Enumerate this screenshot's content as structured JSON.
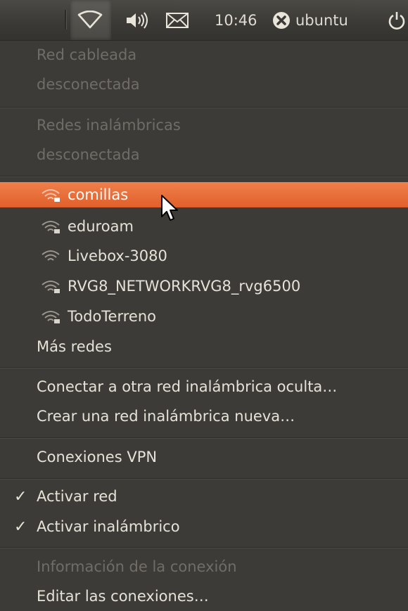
{
  "panel": {
    "time": "10:46",
    "user": "ubuntu"
  },
  "menu": {
    "wired_title": "Red cableada",
    "wired_status": "desconectada",
    "wireless_title": "Redes inalámbricas",
    "wireless_status": "desconectada",
    "networks": [
      {
        "label": "comillas",
        "selected": true
      },
      {
        "label": "eduroam"
      },
      {
        "label": "Livebox-3080"
      },
      {
        "label": "RVG8_NETWORKRVG8_rvg6500"
      },
      {
        "label": "TodoTerreno"
      }
    ],
    "more_networks": "Más redes",
    "connect_hidden": "Conectar a otra red inalámbrica oculta…",
    "create_new": "Crear una red inalámbrica nueva…",
    "vpn": "Conexiones VPN",
    "enable_network": "Activar red",
    "enable_wireless": "Activar inalámbrico",
    "connection_info": "Información de la conexión",
    "edit_connections": "Editar las conexiones…",
    "check_mark": "✓"
  },
  "colors": {
    "selection": "#e8692f",
    "menu_bg": "#3c3b37"
  }
}
